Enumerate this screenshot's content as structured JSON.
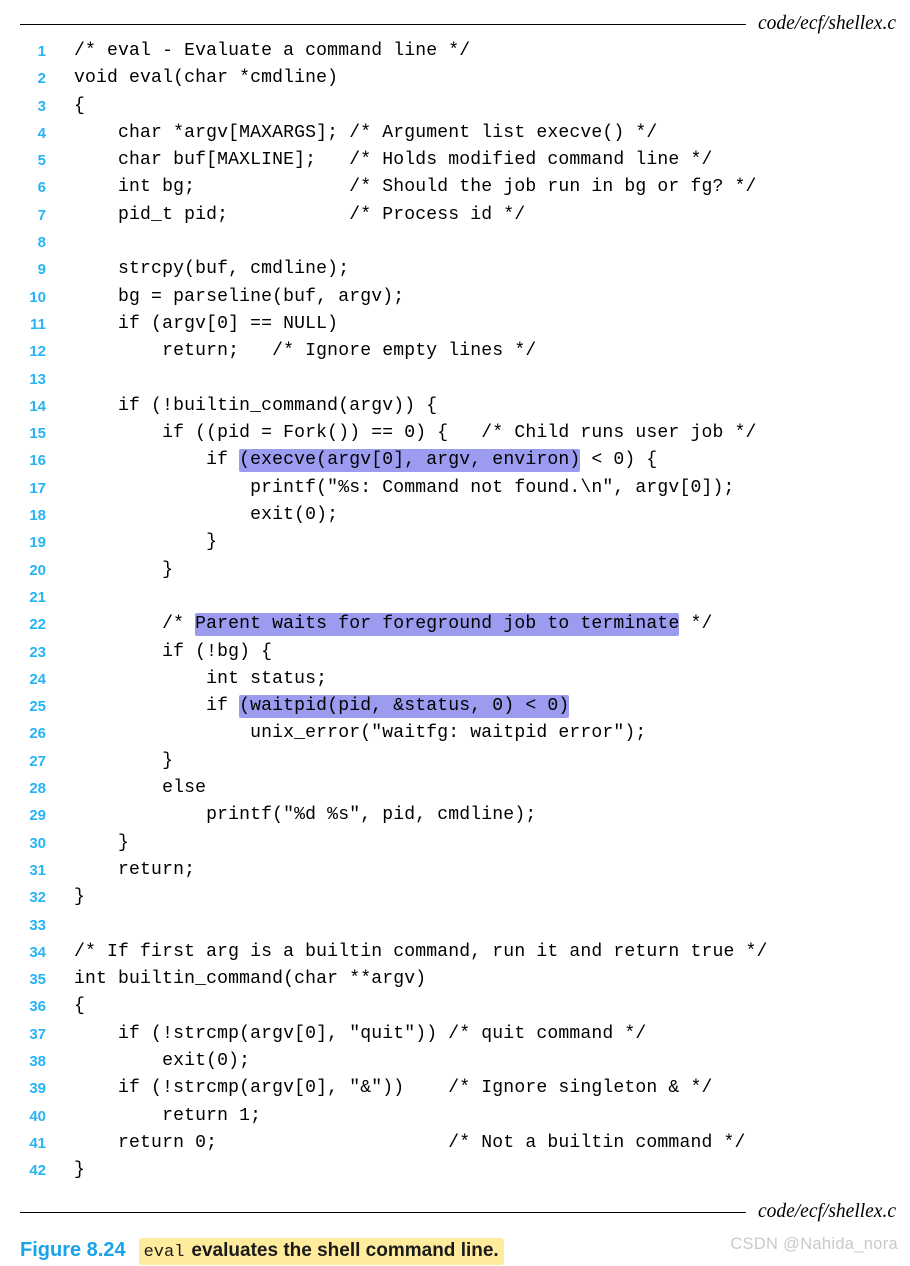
{
  "header": {
    "file_path": "code/ecf/shellex.c"
  },
  "footer": {
    "file_path": "code/ecf/shellex.c"
  },
  "listing": {
    "language": "c",
    "lines": [
      {
        "n": "1",
        "segments": [
          {
            "t": "/* eval - Evaluate a command line */",
            "hl": false
          }
        ]
      },
      {
        "n": "2",
        "segments": [
          {
            "t": "void eval(char *cmdline)",
            "hl": false
          }
        ]
      },
      {
        "n": "3",
        "segments": [
          {
            "t": "{",
            "hl": false
          }
        ]
      },
      {
        "n": "4",
        "segments": [
          {
            "t": "    char *argv[MAXARGS]; /* Argument list execve() */",
            "hl": false
          }
        ]
      },
      {
        "n": "5",
        "segments": [
          {
            "t": "    char buf[MAXLINE];   /* Holds modified command line */",
            "hl": false
          }
        ]
      },
      {
        "n": "6",
        "segments": [
          {
            "t": "    int bg;              /* Should the job run in bg or fg? */",
            "hl": false
          }
        ]
      },
      {
        "n": "7",
        "segments": [
          {
            "t": "    pid_t pid;           /* Process id */",
            "hl": false
          }
        ]
      },
      {
        "n": "8",
        "segments": [
          {
            "t": "",
            "hl": false
          }
        ]
      },
      {
        "n": "9",
        "segments": [
          {
            "t": "    strcpy(buf, cmdline);",
            "hl": false
          }
        ]
      },
      {
        "n": "10",
        "segments": [
          {
            "t": "    bg = parseline(buf, argv);",
            "hl": false
          }
        ]
      },
      {
        "n": "11",
        "segments": [
          {
            "t": "    if (argv[0] == NULL)",
            "hl": false
          }
        ]
      },
      {
        "n": "12",
        "segments": [
          {
            "t": "        return;   /* Ignore empty lines */",
            "hl": false
          }
        ]
      },
      {
        "n": "13",
        "segments": [
          {
            "t": "",
            "hl": false
          }
        ]
      },
      {
        "n": "14",
        "segments": [
          {
            "t": "    if (!builtin_command(argv)) {",
            "hl": false
          }
        ]
      },
      {
        "n": "15",
        "segments": [
          {
            "t": "        if ((pid = Fork()) == 0) {   /* Child runs user job */",
            "hl": false
          }
        ]
      },
      {
        "n": "16",
        "segments": [
          {
            "t": "            if ",
            "hl": false
          },
          {
            "t": "(execve(argv[0], argv, environ)",
            "hl": true
          },
          {
            "t": " < 0) {",
            "hl": false
          }
        ]
      },
      {
        "n": "17",
        "segments": [
          {
            "t": "                printf(\"%s: Command not found.\\n\", argv[0]);",
            "hl": false
          }
        ]
      },
      {
        "n": "18",
        "segments": [
          {
            "t": "                exit(0);",
            "hl": false
          }
        ]
      },
      {
        "n": "19",
        "segments": [
          {
            "t": "            }",
            "hl": false
          }
        ]
      },
      {
        "n": "20",
        "segments": [
          {
            "t": "        }",
            "hl": false
          }
        ]
      },
      {
        "n": "21",
        "segments": [
          {
            "t": "",
            "hl": false
          }
        ]
      },
      {
        "n": "22",
        "segments": [
          {
            "t": "        /* ",
            "hl": false
          },
          {
            "t": "Parent waits for foreground job to terminate",
            "hl": true
          },
          {
            "t": " */",
            "hl": false
          }
        ]
      },
      {
        "n": "23",
        "segments": [
          {
            "t": "        if (!bg) {",
            "hl": false
          }
        ]
      },
      {
        "n": "24",
        "segments": [
          {
            "t": "            int status;",
            "hl": false
          }
        ]
      },
      {
        "n": "25",
        "segments": [
          {
            "t": "            if ",
            "hl": false
          },
          {
            "t": "(waitpid(pid, &status, 0) < 0)",
            "hl": true
          }
        ]
      },
      {
        "n": "26",
        "segments": [
          {
            "t": "                unix_error(\"waitfg: waitpid error\");",
            "hl": false
          }
        ]
      },
      {
        "n": "27",
        "segments": [
          {
            "t": "        }",
            "hl": false
          }
        ]
      },
      {
        "n": "28",
        "segments": [
          {
            "t": "        else",
            "hl": false
          }
        ]
      },
      {
        "n": "29",
        "segments": [
          {
            "t": "            printf(\"%d %s\", pid, cmdline);",
            "hl": false
          }
        ]
      },
      {
        "n": "30",
        "segments": [
          {
            "t": "    }",
            "hl": false
          }
        ]
      },
      {
        "n": "31",
        "segments": [
          {
            "t": "    return;",
            "hl": false
          }
        ]
      },
      {
        "n": "32",
        "segments": [
          {
            "t": "}",
            "hl": false
          }
        ]
      },
      {
        "n": "33",
        "segments": [
          {
            "t": "",
            "hl": false
          }
        ]
      },
      {
        "n": "34",
        "segments": [
          {
            "t": "/* If first arg is a builtin command, run it and return true */",
            "hl": false
          }
        ]
      },
      {
        "n": "35",
        "segments": [
          {
            "t": "int builtin_command(char **argv)",
            "hl": false
          }
        ]
      },
      {
        "n": "36",
        "segments": [
          {
            "t": "{",
            "hl": false
          }
        ]
      },
      {
        "n": "37",
        "segments": [
          {
            "t": "    if (!strcmp(argv[0], \"quit\")) /* quit command */",
            "hl": false
          }
        ]
      },
      {
        "n": "38",
        "segments": [
          {
            "t": "        exit(0);",
            "hl": false
          }
        ]
      },
      {
        "n": "39",
        "segments": [
          {
            "t": "    if (!strcmp(argv[0], \"&\"))    /* Ignore singleton & */",
            "hl": false
          }
        ]
      },
      {
        "n": "40",
        "segments": [
          {
            "t": "        return 1;",
            "hl": false
          }
        ]
      },
      {
        "n": "41",
        "segments": [
          {
            "t": "    return 0;                     /* Not a builtin command */",
            "hl": false
          }
        ]
      },
      {
        "n": "42",
        "segments": [
          {
            "t": "}",
            "hl": false
          }
        ]
      }
    ]
  },
  "caption": {
    "figure_label": "Figure 8.24",
    "code_term": "eval",
    "text": "evaluates the shell command line."
  },
  "watermark": {
    "text": "CSDN @Nahida_nora"
  },
  "colors": {
    "line_number": "#27b3f4",
    "code_highlight": "#9b9bf0",
    "caption_highlight": "#ffeb9c",
    "figure_label": "#1aa3e8",
    "watermark": "#c9c9c9",
    "text": "#000000"
  }
}
